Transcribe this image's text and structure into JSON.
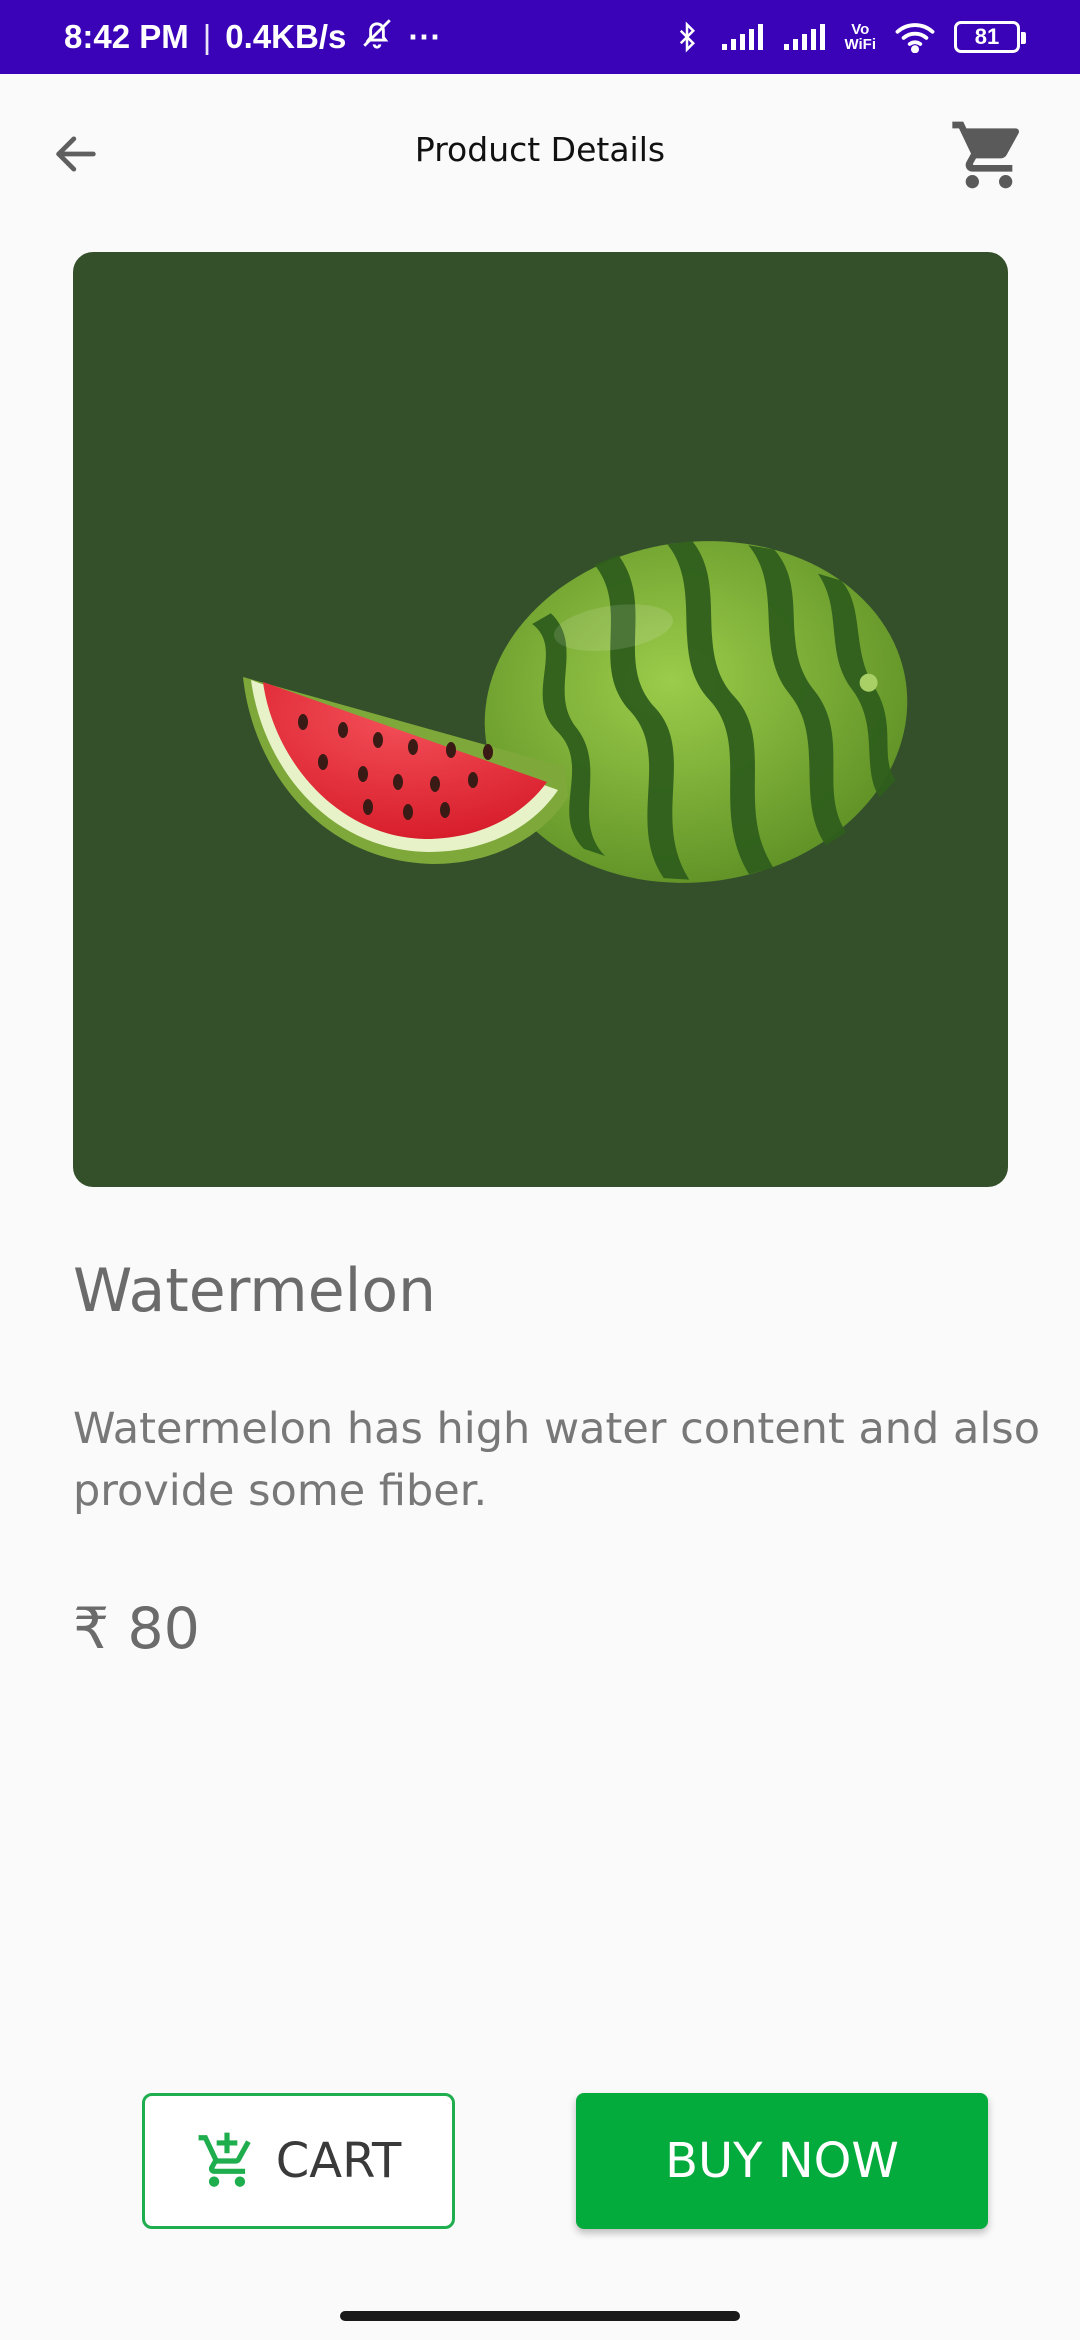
{
  "status_bar": {
    "time": "8:42 PM",
    "separator": "|",
    "speed": "0.4KB/s",
    "more": "···",
    "vowifi_top": "Vo",
    "vowifi_bottom": "WiFi",
    "battery": "81",
    "icons": [
      "bell-off-icon",
      "bluetooth-icon",
      "signal-icon",
      "signal-icon",
      "wifi-icon",
      "battery-icon"
    ]
  },
  "app_bar": {
    "title": "Product Details",
    "back_icon": "arrow-left-icon",
    "cart_icon": "cart-icon"
  },
  "product": {
    "name": "Watermelon",
    "description": "Watermelon has high water content and also provide some fiber.",
    "price": "₹ 80",
    "image_bg": "#34502a"
  },
  "actions": {
    "add_to_cart_label": "CART",
    "buy_now_label": "BUY NOW"
  },
  "colors": {
    "status_bar": "#3a03b8",
    "accent_green": "#03ab3d",
    "outline_green": "#1fae4e"
  }
}
